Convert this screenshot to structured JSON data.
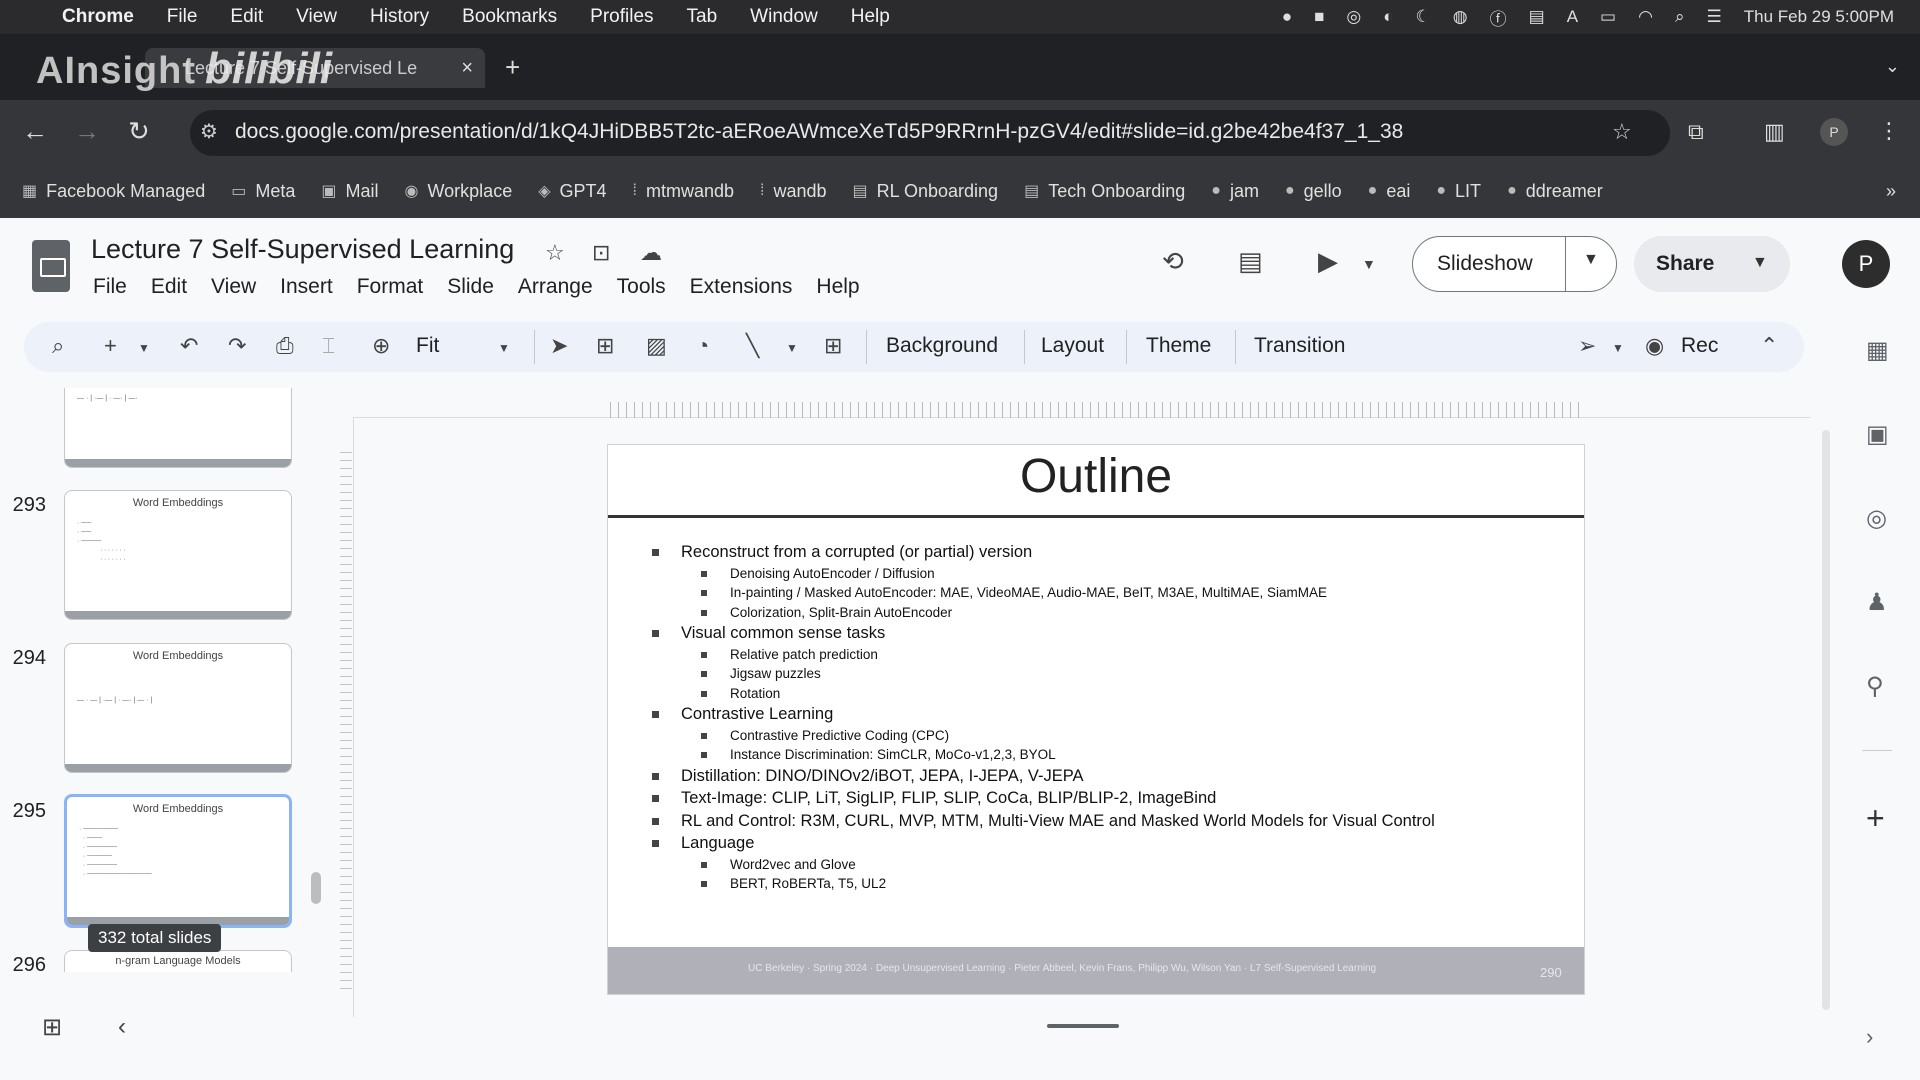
{
  "menubar": {
    "app": "Chrome",
    "items": [
      "File",
      "Edit",
      "View",
      "History",
      "Bookmarks",
      "Profiles",
      "Tab",
      "Window",
      "Help"
    ],
    "datetime": "Thu Feb 29  5:00PM"
  },
  "watermark": {
    "left": "AInsight",
    "right": "bilibili"
  },
  "tab": {
    "title": "Lecture 7 Self-Supervised Le",
    "close": "×",
    "new_tab": "+"
  },
  "address": {
    "url": "docs.google.com/presentation/d/1kQ4JHiDBB5T2tc-aERoeAWmceXeTd5P9RRrnH-pzGV4/edit#slide=id.g2be42be4f37_1_38"
  },
  "bookmarks": [
    {
      "label": "Facebook Managed",
      "icon": "managed-icon"
    },
    {
      "label": "Meta",
      "icon": "folder-icon"
    },
    {
      "label": "Mail",
      "icon": "mail-icon"
    },
    {
      "label": "Workplace",
      "icon": "workplace-icon"
    },
    {
      "label": "GPT4",
      "icon": "gpt-icon"
    },
    {
      "label": "mtmwandb",
      "icon": "wandb-icon"
    },
    {
      "label": "wandb",
      "icon": "wandb-icon"
    },
    {
      "label": "RL Onboarding",
      "icon": "doc-icon"
    },
    {
      "label": "Tech Onboarding",
      "icon": "doc-icon"
    },
    {
      "label": "jam",
      "icon": "github-icon"
    },
    {
      "label": "gello",
      "icon": "github-icon"
    },
    {
      "label": "eai",
      "icon": "github-icon"
    },
    {
      "label": "LIT",
      "icon": "github-icon"
    },
    {
      "label": "ddreamer",
      "icon": "github-icon"
    }
  ],
  "doc": {
    "title": "Lecture 7 Self-Supervised Learning",
    "menus": [
      "File",
      "Edit",
      "View",
      "Insert",
      "Format",
      "Slide",
      "Arrange",
      "Tools",
      "Extensions",
      "Help"
    ],
    "slideshow_label": "Slideshow",
    "share_label": "Share",
    "avatar": "P"
  },
  "toolbar": {
    "zoom": "Fit",
    "background": "Background",
    "layout": "Layout",
    "theme": "Theme",
    "transition": "Transition",
    "rec": "Rec"
  },
  "filmstrip": {
    "tooltip": "332 total slides",
    "slides": [
      {
        "num": "293",
        "title": "Word Embeddings"
      },
      {
        "num": "294",
        "title": "Word Embeddings"
      },
      {
        "num": "295",
        "title": "Word Embeddings"
      },
      {
        "num": "296",
        "title": "n-gram Language Models"
      }
    ]
  },
  "slide": {
    "title": "Outline",
    "bullets": [
      {
        "text": "Reconstruct from a corrupted (or partial) version",
        "sub": [
          "Denoising AutoEncoder / Diffusion",
          "In-painting / Masked AutoEncoder: MAE, VideoMAE, Audio-MAE, BeIT, M3AE, MultiMAE, SiamMAE",
          "Colorization, Split-Brain AutoEncoder"
        ]
      },
      {
        "text": "Visual common sense tasks",
        "sub": [
          "Relative patch prediction",
          "Jigsaw puzzles",
          "Rotation"
        ]
      },
      {
        "text": "Contrastive Learning",
        "sub": [
          "Contrastive Predictive Coding (CPC)",
          "Instance Discrimination: SimCLR, MoCo-v1,2,3, BYOL"
        ]
      },
      {
        "text": "Distillation: DINO/DINOv2/iBOT, JEPA, I-JEPA, V-JEPA",
        "sub": []
      },
      {
        "text": "Text-Image: CLIP, LiT, SigLIP, FLIP, SLIP, CoCa, BLIP/BLIP-2, ImageBind",
        "sub": []
      },
      {
        "text": "RL and Control: R3M, CURL, MVP, MTM, Multi-View MAE and Masked World Models for Visual Control",
        "sub": []
      },
      {
        "text": "Language",
        "sub": [
          "Word2vec and Glove",
          "BERT, RoBERTa, T5, UL2"
        ]
      }
    ],
    "footer": "UC Berkeley  ·  Spring 2024  ·  Deep Unsupervised Learning  ·  Pieter Abbeel, Kevin Frans, Philipp Wu, Wilson Yan  ·  L7 Self-Supervised Learning",
    "page": "290"
  }
}
